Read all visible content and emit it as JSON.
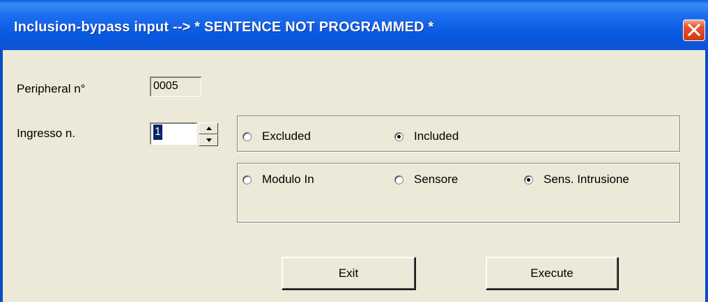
{
  "window": {
    "title": "Inclusion-bypass input --> * SENTENCE NOT PROGRAMMED *"
  },
  "form": {
    "peripheral_label": "Peripheral n°",
    "peripheral_value": "0005",
    "input_label": "Ingresso n.",
    "input_value": "1"
  },
  "state_group": {
    "options": [
      {
        "label": "Excluded",
        "checked": false
      },
      {
        "label": "Included",
        "checked": true
      }
    ]
  },
  "type_group": {
    "options": [
      {
        "label": "Modulo In",
        "checked": false
      },
      {
        "label": "Sensore",
        "checked": false
      },
      {
        "label": "Sens. Intrusione",
        "checked": true
      }
    ]
  },
  "buttons": {
    "exit_label": "Exit",
    "execute_label": "Execute"
  },
  "colors": {
    "titlebar": "#0858E0",
    "window_bg": "#ECE9D8",
    "close_button": "#D33A16",
    "selection": "#0A246A"
  },
  "icons": {
    "close": "close-icon",
    "spin_up": "arrow-up-icon",
    "spin_down": "arrow-down-icon"
  }
}
